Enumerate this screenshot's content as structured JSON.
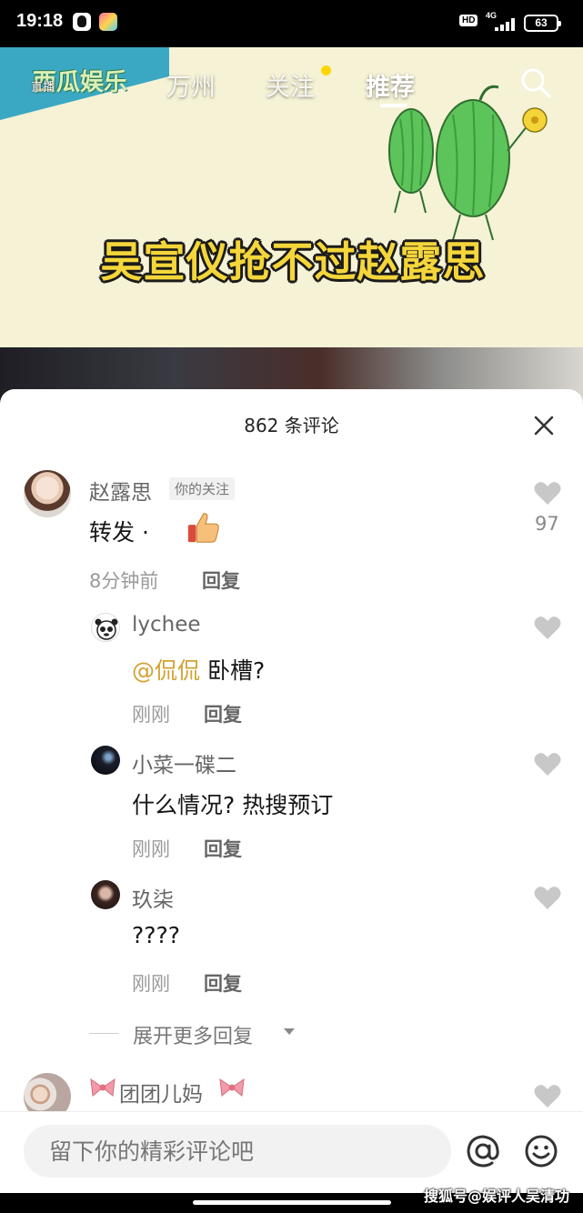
{
  "status_bar": {
    "time": "19:18",
    "hd_label": "HD",
    "network": "4G",
    "battery": "63"
  },
  "video": {
    "logo_text": "西瓜娱乐",
    "live_label": "直播",
    "tabs": [
      "万州",
      "关注",
      "推荐"
    ],
    "active_tab": "推荐",
    "headline": "吴宣仪抢不过赵露思"
  },
  "comments": {
    "title": "862 条评论",
    "items": [
      {
        "name": "赵露思",
        "badge": "你的关注",
        "text": "转发 ·",
        "time": "8分钟前",
        "reply_label": "回复",
        "likes": "97",
        "replies": [
          {
            "name": "lychee",
            "mention": "@侃侃",
            "text": "卧槽?",
            "time": "刚刚",
            "reply_label": "回复"
          },
          {
            "name": "小菜一碟二",
            "text": "什么情况? 热搜预订",
            "time": "刚刚",
            "reply_label": "回复"
          },
          {
            "name": "玖柒",
            "text": "????",
            "time": "刚刚",
            "reply_label": "回复"
          }
        ],
        "expand_label": "展开更多回复"
      },
      {
        "name": "团团儿妈"
      }
    ]
  },
  "input_bar": {
    "placeholder": "留下你的精彩评论吧"
  },
  "watermark": "搜狐号@娱评人吴清功",
  "colors": {
    "mention": "#d4a232",
    "follow_dot": "#ffd500",
    "headline": "#f5d63a",
    "logo_bg": "#3aa8c2"
  },
  "icons": [
    "search-icon",
    "close-icon",
    "heart-icon",
    "thumbs-up-icon",
    "at-icon",
    "emoji-icon",
    "ribbon-icon"
  ]
}
